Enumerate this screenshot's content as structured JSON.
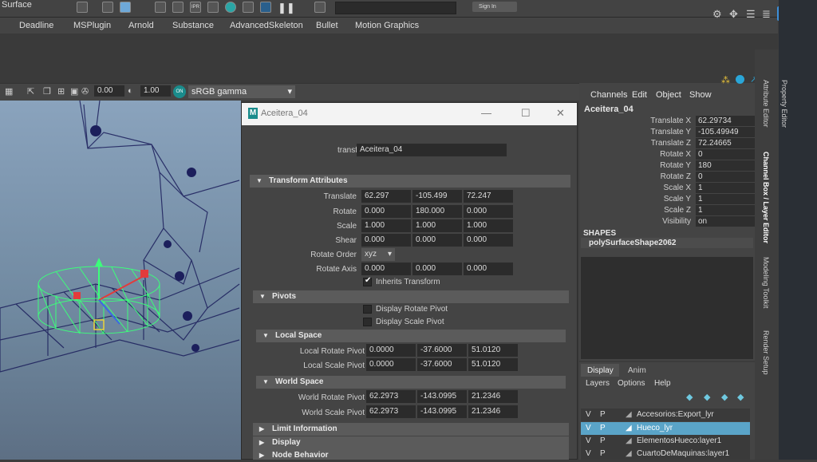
{
  "topbar": {
    "mode": "Surface",
    "signin": "Sign In"
  },
  "shelf_tabs": [
    "Deadline",
    "MSPlugin",
    "Arnold",
    "Substance",
    "AdvancedSkeleton",
    "Bullet",
    "Motion Graphics"
  ],
  "viewport_toolbar": {
    "value1": "0.00",
    "value2": "1.00",
    "colorspace": "sRGB gamma",
    "toggle": "ON"
  },
  "dialog": {
    "title": "Aceitera_04",
    "transform_label": "transform:",
    "transform_value": "Aceitera_04",
    "sections": {
      "transform_attributes": "Transform Attributes",
      "pivots": "Pivots",
      "local_space": "Local Space",
      "world_space": "World Space",
      "limit_information": "Limit Information",
      "display": "Display",
      "node_behavior": "Node Behavior"
    },
    "translate": {
      "label": "Translate",
      "x": "62.297",
      "y": "-105.499",
      "z": "72.247"
    },
    "rotate": {
      "label": "Rotate",
      "x": "0.000",
      "y": "180.000",
      "z": "0.000"
    },
    "scale": {
      "label": "Scale",
      "x": "1.000",
      "y": "1.000",
      "z": "1.000"
    },
    "shear": {
      "label": "Shear",
      "x": "0.000",
      "y": "0.000",
      "z": "0.000"
    },
    "rotate_order": {
      "label": "Rotate Order",
      "value": "xyz"
    },
    "rotate_axis": {
      "label": "Rotate Axis",
      "x": "0.000",
      "y": "0.000",
      "z": "0.000"
    },
    "inherits_transform": {
      "label": "Inherits Transform",
      "checked": true
    },
    "display_rotate_pivot": {
      "label": "Display Rotate Pivot",
      "checked": false
    },
    "display_scale_pivot": {
      "label": "Display Scale Pivot",
      "checked": false
    },
    "local_rotate_pivot": {
      "label": "Local Rotate Pivot",
      "x": "0.0000",
      "y": "-37.6000",
      "z": "51.0120"
    },
    "local_scale_pivot": {
      "label": "Local Scale Pivot",
      "x": "0.0000",
      "y": "-37.6000",
      "z": "51.0120"
    },
    "world_rotate_pivot": {
      "label": "World Rotate Pivot",
      "x": "62.2973",
      "y": "-143.0995",
      "z": "21.2346"
    },
    "world_scale_pivot": {
      "label": "World Scale Pivot",
      "x": "62.2973",
      "y": "-143.0995",
      "z": "21.2346"
    }
  },
  "channel_box": {
    "menu": [
      "Channels",
      "Edit",
      "Object",
      "Show"
    ],
    "object": "Aceitera_04",
    "channels": [
      {
        "name": "Translate X",
        "value": "62.29734"
      },
      {
        "name": "Translate Y",
        "value": "-105.49949"
      },
      {
        "name": "Translate Z",
        "value": "72.24665"
      },
      {
        "name": "Rotate X",
        "value": "0"
      },
      {
        "name": "Rotate Y",
        "value": "180"
      },
      {
        "name": "Rotate Z",
        "value": "0"
      },
      {
        "name": "Scale X",
        "value": "1"
      },
      {
        "name": "Scale Y",
        "value": "1"
      },
      {
        "name": "Scale Z",
        "value": "1"
      },
      {
        "name": "Visibility",
        "value": "on"
      }
    ],
    "shapes_header": "SHAPES",
    "shape_name": "polySurfaceShape2062"
  },
  "layer_editor": {
    "tabs": [
      "Display",
      "Anim"
    ],
    "menu": [
      "Layers",
      "Options",
      "Help"
    ],
    "layers": [
      {
        "v": "V",
        "p": "P",
        "name": "Accesorios:Export_lyr",
        "selected": false
      },
      {
        "v": "V",
        "p": "P",
        "name": "Hueco_lyr",
        "selected": true
      },
      {
        "v": "V",
        "p": "P",
        "name": "ElementosHueco:layer1",
        "selected": false
      },
      {
        "v": "V",
        "p": "P",
        "name": "CuartoDeMaquinas:layer1",
        "selected": false
      }
    ]
  },
  "side_tabs": [
    "Attribute Editor",
    "Channel Box / Layer Editor",
    "Modeling Toolkit",
    "Render Setup"
  ],
  "right_edge_tab": "Property Editor",
  "colors": {
    "selected_layer": "#5aa4c8",
    "accent_teal": "#1a8c8c",
    "wireframe_green": "#3cff7a"
  }
}
